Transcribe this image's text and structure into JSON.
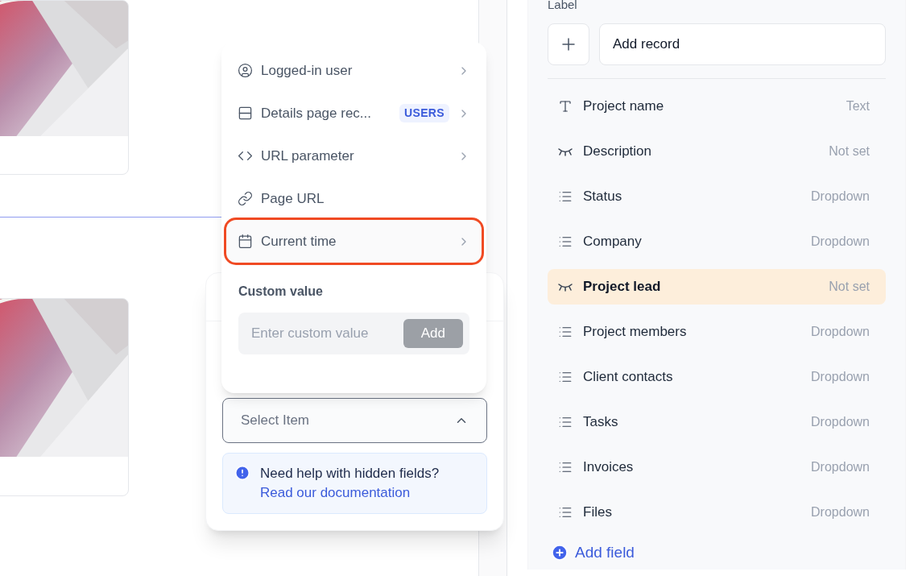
{
  "menu": {
    "items": [
      {
        "label": "Logged-in user",
        "kind": "user",
        "submenu": true,
        "highlighted": false
      },
      {
        "label": "Details page rec...",
        "kind": "record",
        "badge": "USERS",
        "submenu": true,
        "highlighted": false
      },
      {
        "label": "URL parameter",
        "kind": "code",
        "submenu": true,
        "highlighted": false
      },
      {
        "label": "Page URL",
        "kind": "link",
        "submenu": false,
        "highlighted": false
      },
      {
        "label": "Current time",
        "kind": "calendar",
        "submenu": true,
        "highlighted": true
      }
    ],
    "custom_value": {
      "label": "Custom value",
      "placeholder": "Enter custom value",
      "button": "Add"
    }
  },
  "select": {
    "placeholder": "Select Item",
    "expanded": true
  },
  "help": {
    "title": "Need help with hidden fields?",
    "link": "Read our documentation"
  },
  "panel": {
    "label": "Label",
    "record_placeholder": "Add record",
    "fields": [
      {
        "name": "Project name",
        "type": "Text",
        "kind": "text",
        "selected": false
      },
      {
        "name": "Description",
        "type": "Not set",
        "kind": "hidden",
        "selected": false
      },
      {
        "name": "Status",
        "type": "Dropdown",
        "kind": "list",
        "selected": false
      },
      {
        "name": "Company",
        "type": "Dropdown",
        "kind": "list",
        "selected": false
      },
      {
        "name": "Project lead",
        "type": "Not set",
        "kind": "hidden",
        "selected": true
      },
      {
        "name": "Project members",
        "type": "Dropdown",
        "kind": "list",
        "selected": false
      },
      {
        "name": "Client contacts",
        "type": "Dropdown",
        "kind": "list",
        "selected": false
      },
      {
        "name": "Tasks",
        "type": "Dropdown",
        "kind": "list",
        "selected": false
      },
      {
        "name": "Invoices",
        "type": "Dropdown",
        "kind": "list",
        "selected": false
      },
      {
        "name": "Files",
        "type": "Dropdown",
        "kind": "list",
        "selected": false
      }
    ],
    "add_field": "Add field"
  }
}
